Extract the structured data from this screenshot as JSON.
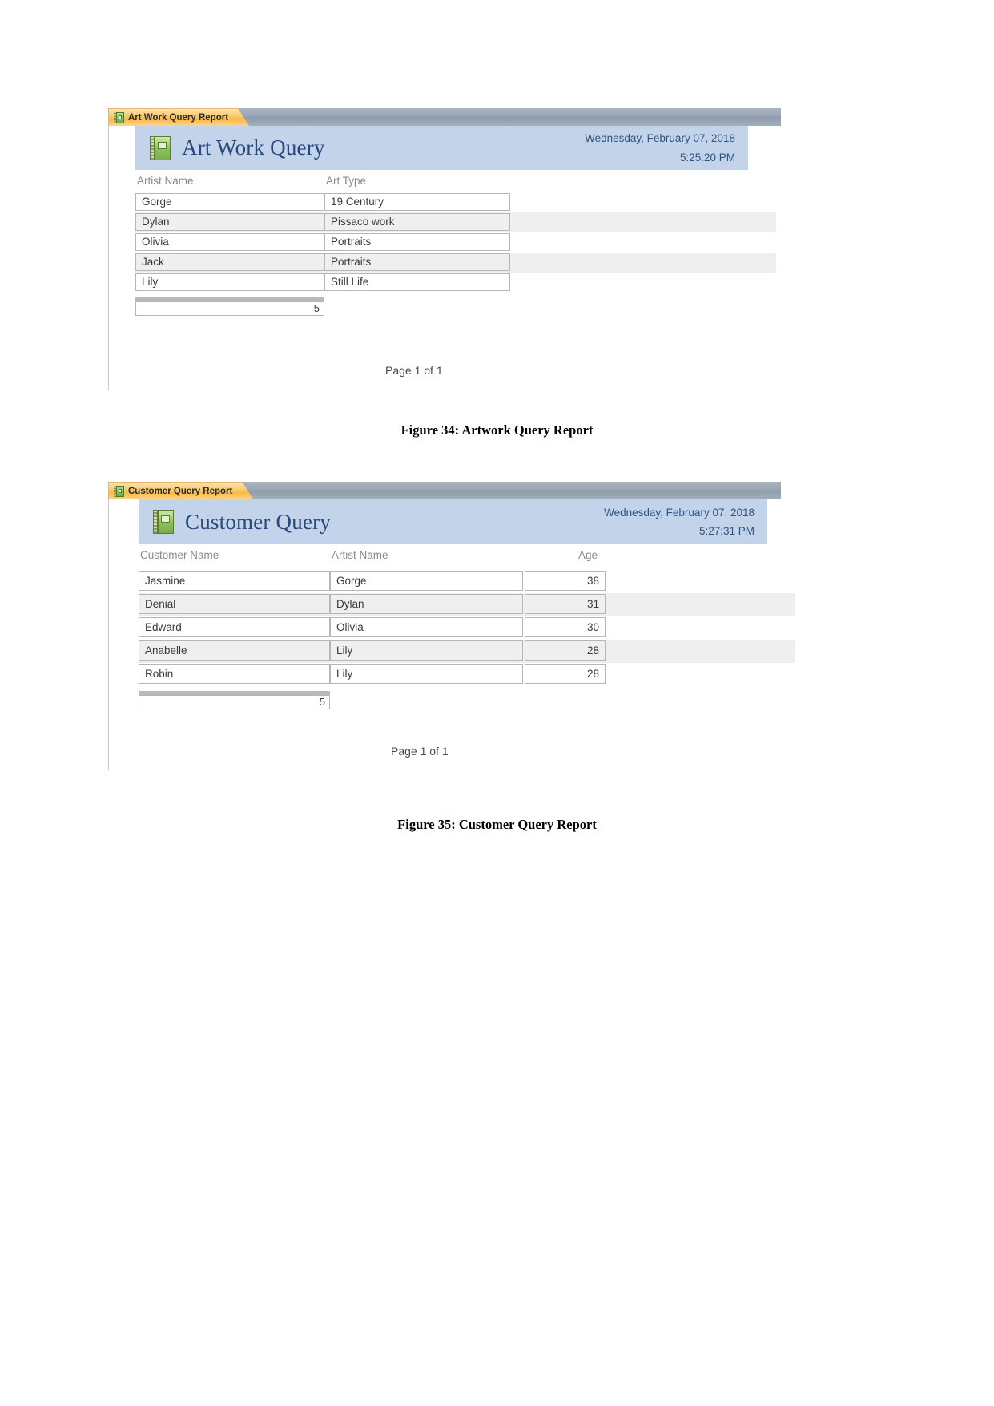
{
  "document": {
    "page_background": "#ffffff",
    "accent_blue": "#c3d4ea",
    "title_color": "#28477d",
    "tab_orange": "#f9b948"
  },
  "reports": [
    {
      "tab": {
        "label": "Art Work Query Report",
        "icon": "report-notebook-icon"
      },
      "header": {
        "title": "Art Work Query",
        "icon": "report-notebook-icon",
        "date": "Wednesday, February 07, 2018",
        "time": "5:25:20 PM"
      },
      "columns": [
        "Artist Name",
        "Art Type"
      ],
      "rows": [
        {
          "artist_name": "Gorge",
          "art_type": "19 Century"
        },
        {
          "artist_name": "Dylan",
          "art_type": "Pissaco work"
        },
        {
          "artist_name": "Olivia",
          "art_type": "Portraits"
        },
        {
          "artist_name": "Jack",
          "art_type": "Portraits"
        },
        {
          "artist_name": "Lily",
          "art_type": "Still Life"
        }
      ],
      "count": "5",
      "page_footer": "Page 1 of 1"
    },
    {
      "tab": {
        "label": "Customer Query Report",
        "icon": "report-notebook-icon"
      },
      "header": {
        "title": "Customer Query",
        "icon": "report-notebook-icon",
        "date": "Wednesday, February 07, 2018",
        "time": "5:27:31 PM"
      },
      "columns": [
        "Customer Name",
        "Artist Name",
        "Age"
      ],
      "rows": [
        {
          "customer_name": "Jasmine",
          "artist_name": "Gorge",
          "age": "38"
        },
        {
          "customer_name": "Denial",
          "artist_name": "Dylan",
          "age": "31"
        },
        {
          "customer_name": "Edward",
          "artist_name": "Olivia",
          "age": "30"
        },
        {
          "customer_name": "Anabelle",
          "artist_name": "Lily",
          "age": "28"
        },
        {
          "customer_name": "Robin",
          "artist_name": "Lily",
          "age": "28"
        }
      ],
      "count": "5",
      "page_footer": "Page 1 of 1"
    }
  ],
  "captions": [
    "Figure 34: Artwork Query Report",
    "Figure 35: Customer Query Report"
  ]
}
